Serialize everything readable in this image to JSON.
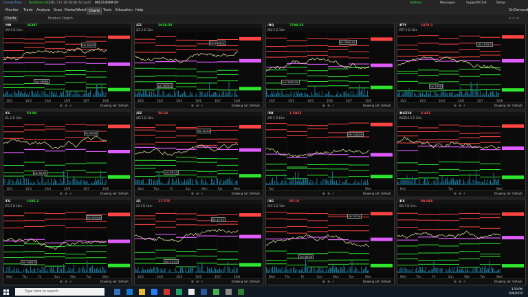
{
  "titlebar": {
    "left_items": [
      "ConnecTime",
      "Realtime data",
      "DEL 5",
      "Cl 10:16:48",
      "Account",
      "86521404M (P)"
    ],
    "right_items": [
      "Hotkeys",
      "Messages",
      "Support/Chat",
      "Setup"
    ]
  },
  "menu": [
    "Monitor",
    "Trade",
    "Analyze",
    "Scan",
    "MarketWatch",
    "Charts",
    "Tools",
    "Education",
    "Help"
  ],
  "menu_active": "Charts",
  "right_menu": "OnDemand",
  "toolbar": {
    "charts_tab": "Charts",
    "product_depth": "Product Depth"
  },
  "drawing_set": "Drawing set: Default",
  "panels": [
    {
      "symbol": "/YM",
      "last": "26387",
      "dir": "up",
      "sub": "/YM 5 D 10m",
      "xlabels": [
        "10/2",
        "10/3",
        "10/4",
        "10/6",
        "10/7",
        "10/8"
      ],
      "lo_label": "Lo: 26083",
      "hi_label": "Hi: 26477",
      "seed": 11
    },
    {
      "symbol": "/ES",
      "last": "2918.25",
      "dir": "up",
      "sub": "/ES 5 D 10m",
      "xlabels": [
        "10/2",
        "10/3",
        "10/4",
        "10/6",
        "10/7",
        "10/8"
      ],
      "lo_label": "Lo: 2878.5",
      "hi_label": "Hi: 2932.5",
      "seed": 23
    },
    {
      "symbol": "/NQ",
      "last": "7790.25",
      "dir": "up",
      "sub": "/NQ 5 D 10m",
      "xlabels": [
        "10/2",
        "10/3",
        "10/4",
        "10/6",
        "10/7",
        "10/8"
      ],
      "lo_label": "Lo: 7655.25",
      "hi_label": "Hi: 7805.25",
      "seed": 37
    },
    {
      "symbol": "/RTY",
      "last": "1479.3",
      "dir": "dn",
      "sub": "/RTY 5 D 10m",
      "xlabels": [
        "10/2",
        "10/3",
        "10/4",
        "10/6",
        "10/7",
        "10/8"
      ],
      "lo_label": "Lo: 1458",
      "hi_label": "Hi: 1519.7",
      "seed": 41
    },
    {
      "symbol": "/CL",
      "last": "52.89",
      "dir": "up",
      "sub": "/CL 5 D 10m",
      "xlabels": [
        "10/2",
        "10/3",
        "10/4",
        "10/6",
        "10/7",
        "10/8"
      ],
      "lo_label": "Lo: 50.99",
      "hi_label": "Hi: 54.00",
      "seed": 53
    },
    {
      "symbol": "/BZ",
      "last": "58.64",
      "dir": "dn",
      "sub": "/BZ 5 D 10m",
      "xlabels": [
        "Wed",
        "Thu",
        "Fri",
        "Sun",
        "Mon",
        "Tue",
        "Wed"
      ],
      "lo_label": "Lo: 56.13",
      "hi_label": "Hi: 59.01",
      "seed": 67
    },
    {
      "symbol": "/RB",
      "last": "1.5963",
      "dir": "dn",
      "sub": "/RB 5 D 10m",
      "xlabels": [
        "Tue",
        "Wed"
      ],
      "lo_label": "",
      "hi_label": "Hi: 1.6126",
      "seed": 71
    },
    {
      "symbol": "/NGZ19",
      "last": "2.441",
      "dir": "dn",
      "sub": "/NGZ19 5 D 10m",
      "xlabels": [
        "Mon",
        "Tue",
        "Wed"
      ],
      "lo_label": "",
      "hi_label": "",
      "seed": 83
    },
    {
      "symbol": "/FG",
      "last": "1505.2",
      "dir": "up",
      "sub": "/FG 5 D 10m",
      "xlabels": [
        "Wed",
        "Thu",
        "Fri",
        "Sun",
        "Mon",
        "Tue",
        "Wed"
      ],
      "lo_label": "Lo: 1480.3",
      "hi_label": "Hi: 1516.8",
      "seed": 97
    },
    {
      "symbol": "/SI",
      "last": "17.775",
      "dir": "dn",
      "sub": "/SI 5 D 10m",
      "xlabels": [
        "10/2",
        "10/3",
        "10/4",
        "10/6",
        "10/7",
        "10/8"
      ],
      "lo_label": "Lo: 17.24",
      "hi_label": "Hi: 17.72",
      "seed": 101
    },
    {
      "symbol": "/HG",
      "last": "95.10",
      "dir": "dn",
      "sub": "/HG 5 D 10m",
      "xlabels": [
        "Wed",
        "Thu",
        "Fri",
        "Sun",
        "Mon",
        "Tue",
        "Wed"
      ],
      "lo_label": "Lo: 96.00",
      "hi_label": "Hi: 102.6",
      "seed": 113
    },
    {
      "symbol": "/DX",
      "last": "98.888",
      "dir": "dn",
      "sub": "/DX 5 D 10m",
      "xlabels": [
        "Wed",
        "Thu",
        "Fri",
        "Sun",
        "Mon",
        "Tue",
        "Wed"
      ],
      "lo_label": "",
      "hi_label": "",
      "seed": 127
    }
  ],
  "taskbar": {
    "search_placeholder": "Type here to search",
    "time": "3:19 PM",
    "date": "10/9/2019"
  }
}
